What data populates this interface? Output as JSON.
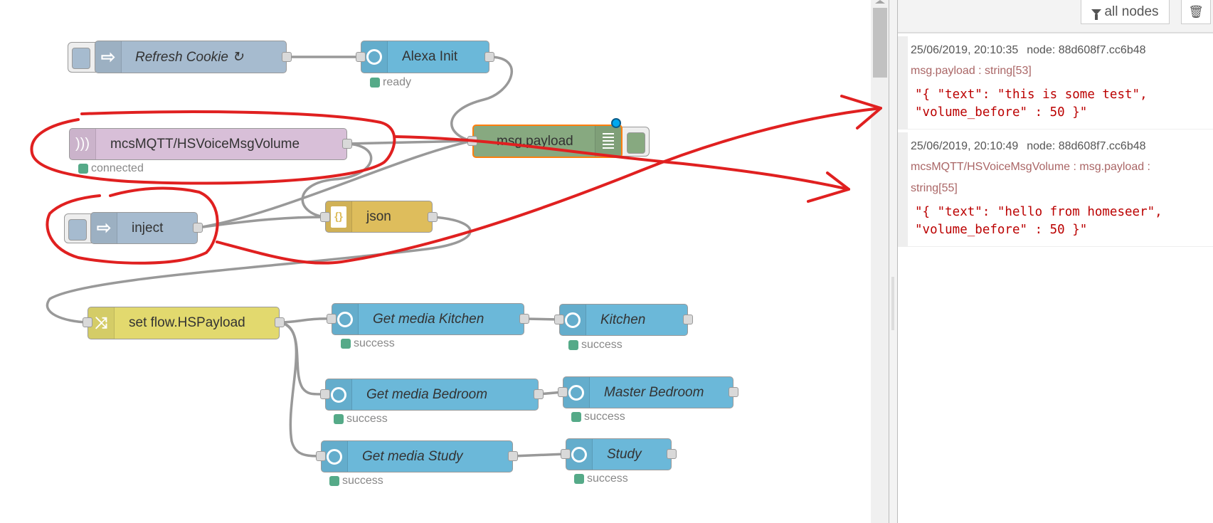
{
  "flow": {
    "nodes": [
      {
        "id": "refresh-cookie",
        "label": "Refresh Cookie ↻",
        "type": "inject",
        "icon": "arrow-right-icon"
      },
      {
        "id": "alexa-init",
        "label": "Alexa Init",
        "type": "alexa",
        "icon": "ring-icon",
        "status": "ready"
      },
      {
        "id": "mqtt-in",
        "label": "mcsMQTT/HSVoiceMsgVolume",
        "type": "mqtt-in",
        "icon": "radio-waves-icon",
        "status": "connected"
      },
      {
        "id": "msg-payload",
        "label": "msg.payload",
        "type": "debug",
        "icon": "list-lines-icon"
      },
      {
        "id": "inject",
        "label": "inject",
        "type": "inject",
        "icon": "arrow-right-icon"
      },
      {
        "id": "json",
        "label": "json",
        "type": "json",
        "icon": "braces-icon"
      },
      {
        "id": "set-flow",
        "label": "set flow.HSPayload",
        "type": "change",
        "icon": "shuffle-icon"
      },
      {
        "id": "get-media-kitchen",
        "label": "Get media Kitchen",
        "type": "alexa",
        "icon": "ring-icon",
        "status": "success"
      },
      {
        "id": "kitchen",
        "label": "Kitchen",
        "type": "alexa",
        "icon": "ring-icon",
        "status": "success"
      },
      {
        "id": "get-media-bedroom",
        "label": "Get media Bedroom",
        "type": "alexa",
        "icon": "ring-icon",
        "status": "success"
      },
      {
        "id": "master-bedroom",
        "label": "Master Bedroom",
        "type": "alexa",
        "icon": "ring-icon",
        "status": "success"
      },
      {
        "id": "get-media-study",
        "label": "Get media Study",
        "type": "alexa",
        "icon": "ring-icon",
        "status": "success"
      },
      {
        "id": "study",
        "label": "Study",
        "type": "alexa",
        "icon": "ring-icon",
        "status": "success"
      }
    ]
  },
  "colors": {
    "inject": "#a6bbcf",
    "alexa": "#6bb8d9",
    "mqtt": "#d8bfd8",
    "debug": "#87a980",
    "json": "#debd5c",
    "change": "#e2d96e",
    "status_green": "#5a8",
    "annotation": "#e02020",
    "selected_border": "#ff7f0e"
  },
  "sidebar": {
    "filter_label": "all nodes",
    "trash_icon": "trash-icon",
    "messages": [
      {
        "timestamp": "25/06/2019, 20:10:35",
        "node": "node: 88d608f7.cc6b48",
        "topic": "msg.payload : string[53]",
        "payload": "\"{ \"text\": \"this is some test\",\n\"volume_before\" : 50 }\""
      },
      {
        "timestamp": "25/06/2019, 20:10:49",
        "node": "node: 88d608f7.cc6b48",
        "topic": "mcsMQTT/HSVoiceMsgVolume : msg.payload : string[55]",
        "payload": "\"{ \"text\": \"hello from homeseer\",\n\"volume_before\" : 50 }\""
      }
    ]
  }
}
